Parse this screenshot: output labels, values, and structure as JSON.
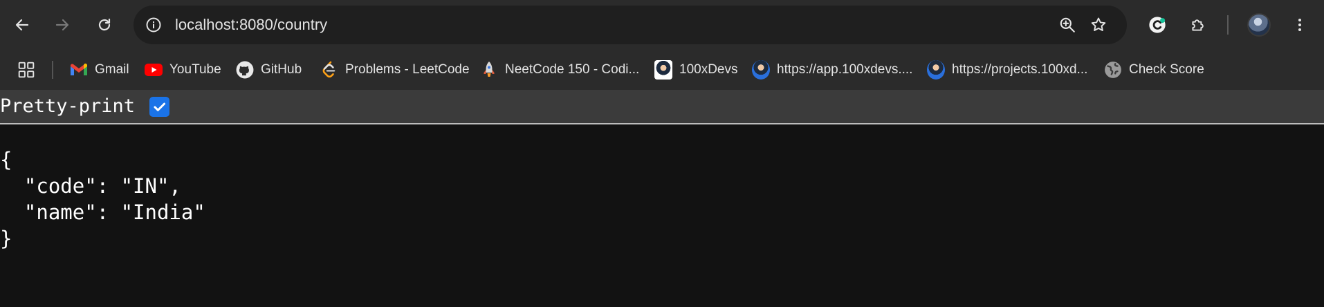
{
  "browser": {
    "url": "localhost:8080/country",
    "nav": {
      "back_icon": "arrow-left-icon",
      "forward_icon": "arrow-right-icon",
      "reload_icon": "reload-icon"
    },
    "omnibox_icons": [
      "info-icon",
      "zoom-in-icon",
      "bookmark-star-icon"
    ],
    "toolbar_icons": [
      "grammarly-extension-icon",
      "extensions-puzzle-icon",
      "profile-avatar",
      "more-vert-icon"
    ]
  },
  "bookmarks": [
    {
      "label": "Gmail",
      "icon": "gmail-icon"
    },
    {
      "label": "YouTube",
      "icon": "youtube-icon"
    },
    {
      "label": "GitHub",
      "icon": "github-icon"
    },
    {
      "label": "Problems - LeetCode",
      "icon": "leetcode-icon"
    },
    {
      "label": "NeetCode 150 - Codi...",
      "icon": "rocket-icon"
    },
    {
      "label": "100xDevs",
      "icon": "person-avatar-icon"
    },
    {
      "label": "https://app.100xdevs....",
      "icon": "person-avatar-icon"
    },
    {
      "label": "https://projects.100xd...",
      "icon": "person-avatar-icon"
    },
    {
      "label": "Check Score",
      "icon": "globe-icon"
    }
  ],
  "viewer": {
    "pretty_print_label": "Pretty-print",
    "pretty_print_checked": true
  },
  "json_lines": [
    "{",
    "  \"code\": \"IN\",",
    "  \"name\": \"India\"",
    "}"
  ],
  "colors": {
    "toolbar_bg": "#2b2b2b",
    "omnibox_bg": "#1f1f1f",
    "page_bg": "#121212",
    "checkbox_accent": "#1a73e8"
  }
}
